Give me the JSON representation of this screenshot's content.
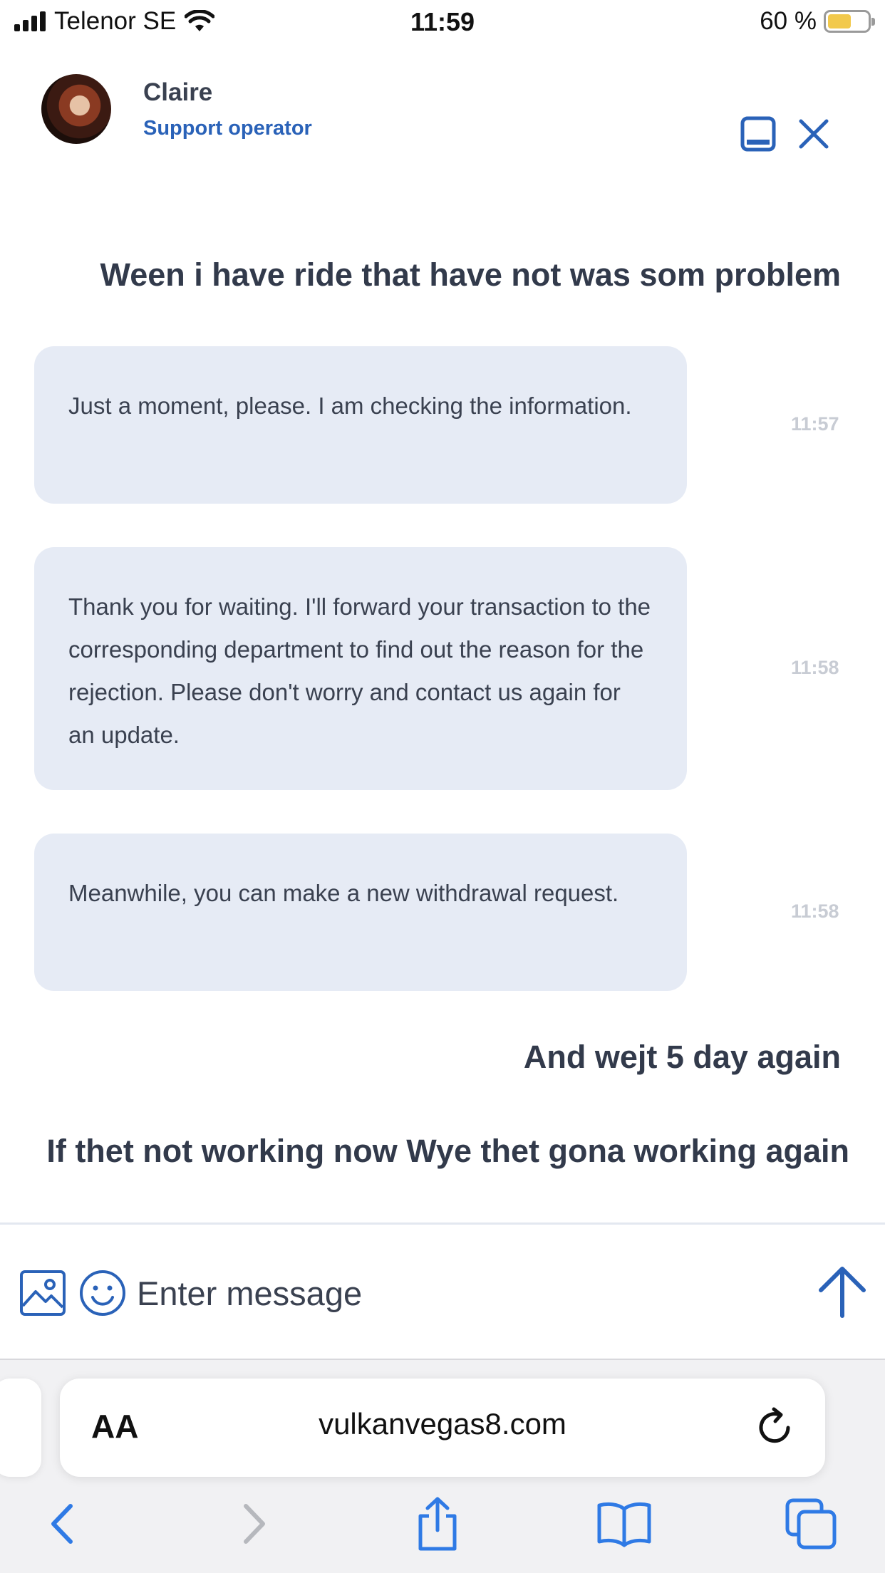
{
  "status_bar": {
    "carrier": "Telenor SE",
    "time": "11:59",
    "battery_percent": "60 %",
    "battery_level": 0.6
  },
  "header": {
    "operator_name": "Claire",
    "operator_role": "Support operator",
    "icons": {
      "minimize": "minimize-window-icon",
      "close": "close-icon"
    }
  },
  "messages": [
    {
      "sender": "user",
      "text": "Ween i have ride that have not was som problem"
    },
    {
      "sender": "operator",
      "text": "Just a moment, please. I am checking the information.",
      "time": "11:57"
    },
    {
      "sender": "operator",
      "text": "Thank you for waiting. I'll forward your transaction to the corresponding department to find out the reason for the rejection. Please don't worry and contact us again for an update.",
      "time": "11:58"
    },
    {
      "sender": "operator",
      "text": "Meanwhile, you can make a new withdrawal request.",
      "time": "11:58"
    },
    {
      "sender": "user",
      "text": "And wejt 5 day again"
    },
    {
      "sender": "user",
      "text": "If thet not working now Wye thet gona working again"
    }
  ],
  "composer": {
    "placeholder": "Enter message",
    "value": "",
    "icons": {
      "attach_image": "image-icon",
      "emoji": "smiley-icon",
      "send": "arrow-up-icon"
    }
  },
  "browser": {
    "text_size_label": "AA",
    "url": "vulkanvegas8.com",
    "icons": [
      "back-icon",
      "forward-icon",
      "share-icon",
      "bookmarks-icon",
      "tabs-icon",
      "reload-icon"
    ]
  },
  "colors": {
    "accent": "#2a62b8",
    "bubble_bg": "#e6ebf5",
    "text": "#3a4150",
    "timestamp": "#c8ccd4"
  }
}
